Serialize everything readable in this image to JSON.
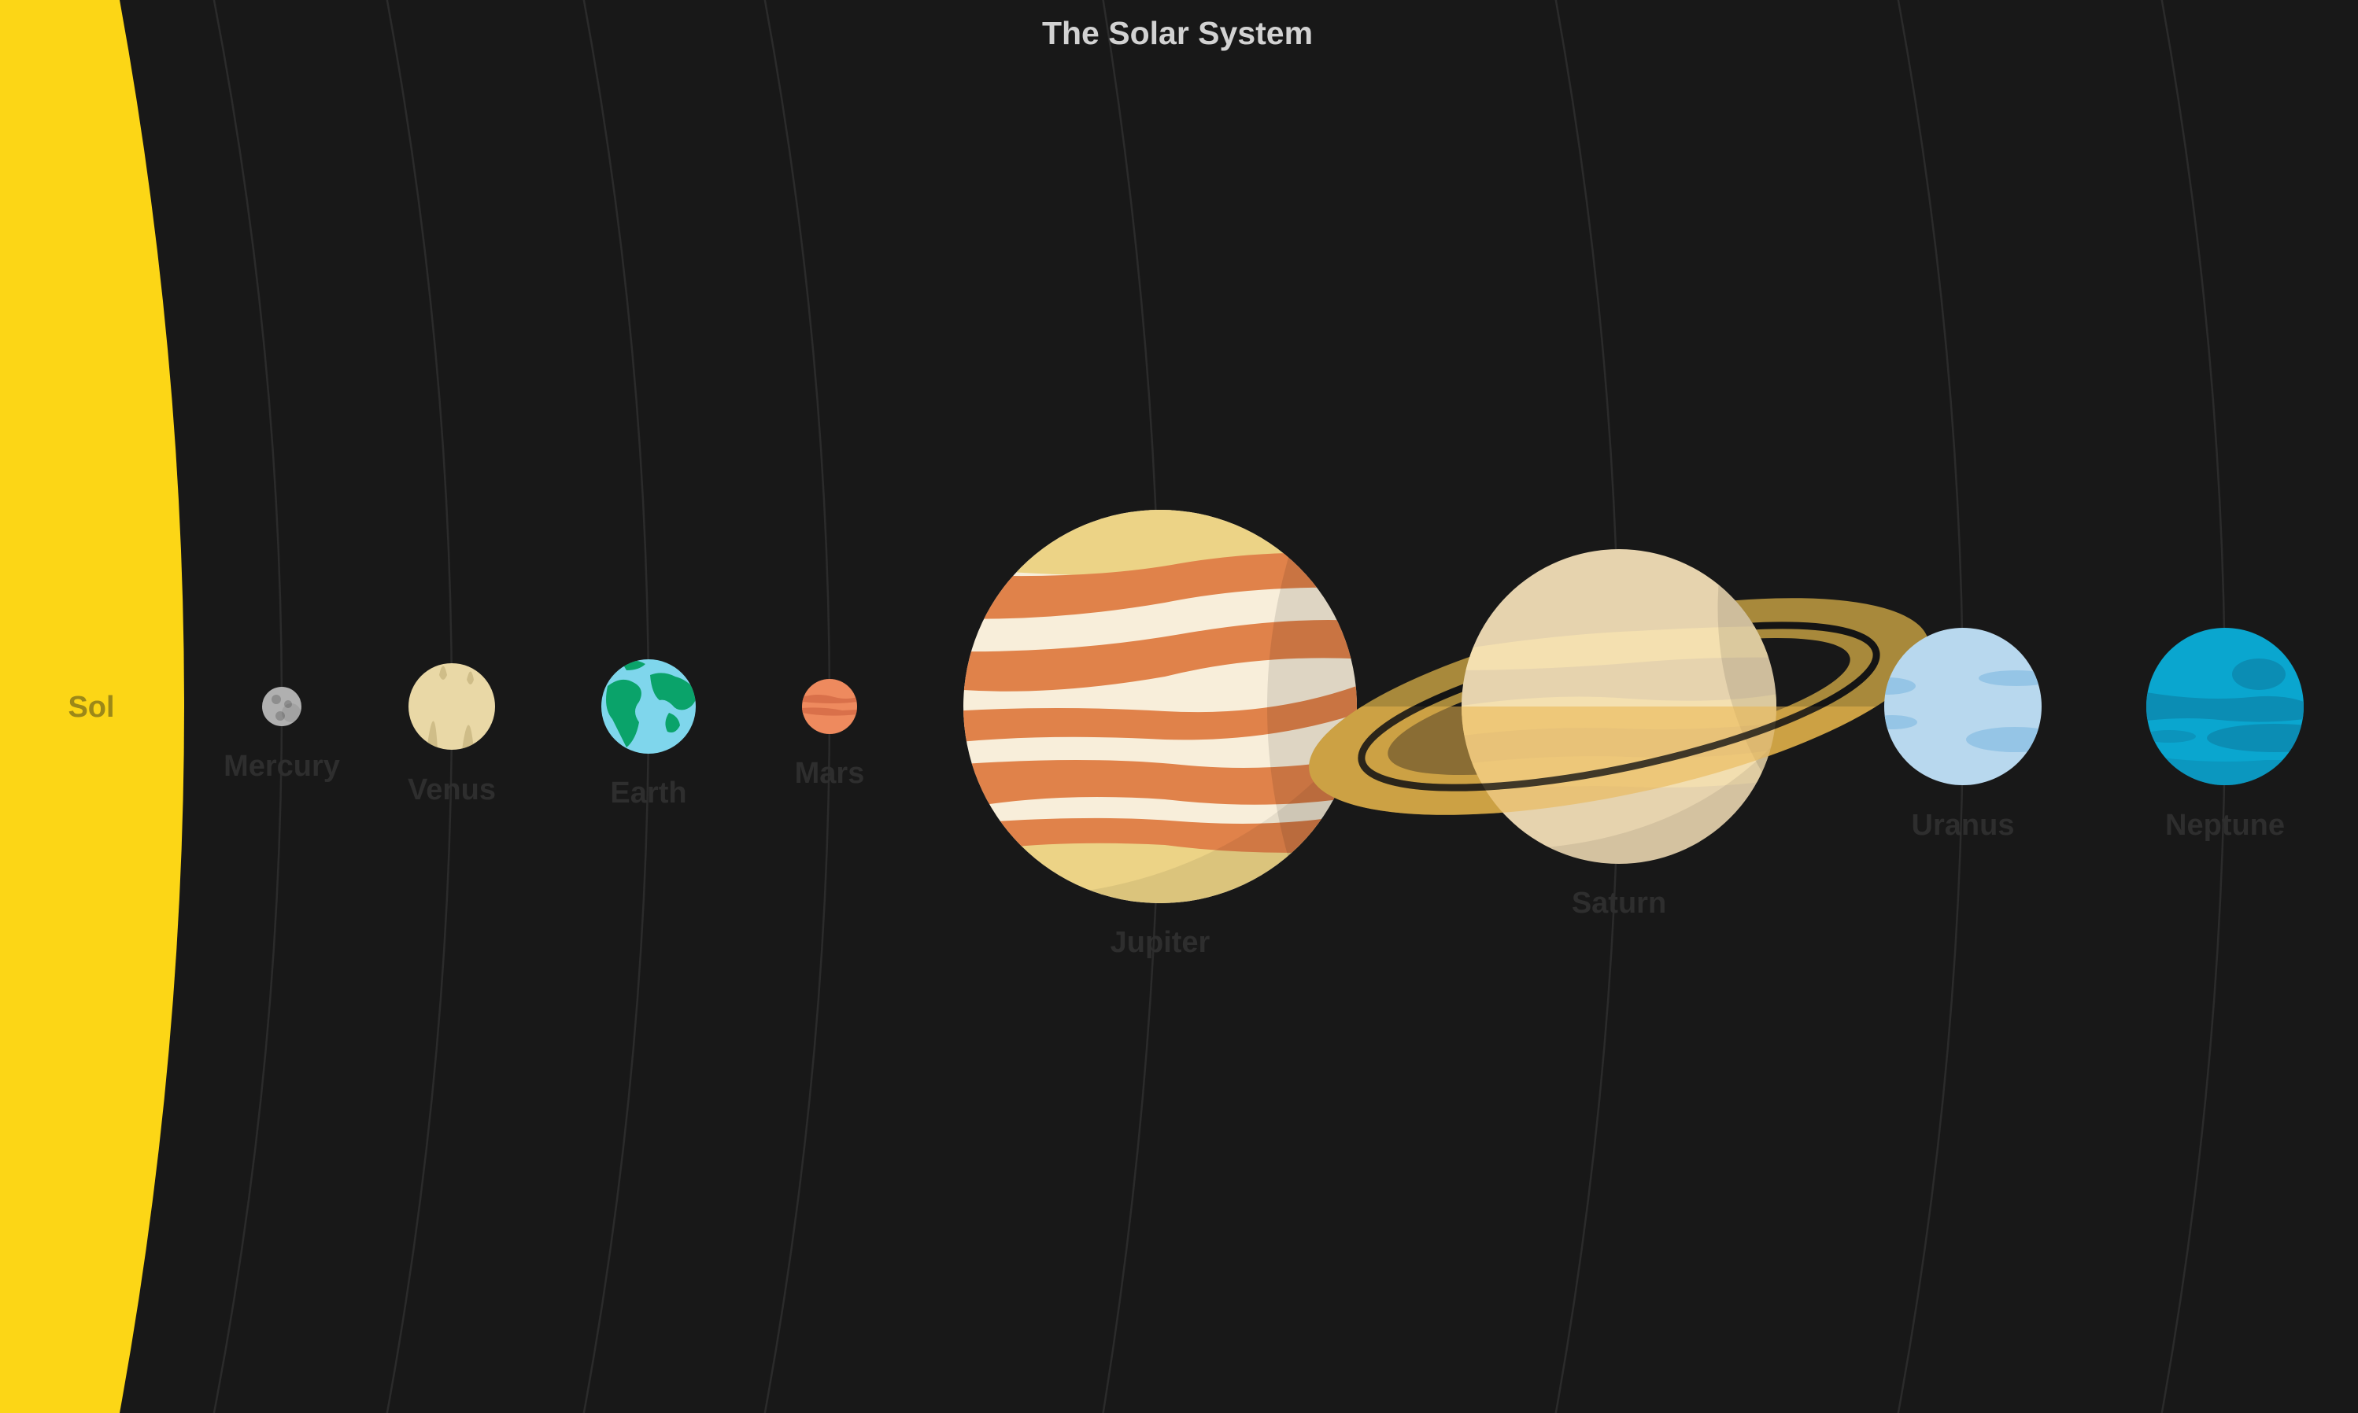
{
  "title": "The Solar System",
  "sun": {
    "label": "Sol",
    "color": "#fcd616"
  },
  "planets": [
    {
      "key": "mercury",
      "label": "Mercury",
      "color": "#b0b0b0"
    },
    {
      "key": "venus",
      "label": "Venus",
      "color": "#e9d8a6"
    },
    {
      "key": "earth",
      "label": "Earth",
      "color": "#7fd6ec"
    },
    {
      "key": "mars",
      "label": "Mars",
      "color": "#ee8a5e"
    },
    {
      "key": "jupiter",
      "label": "Jupiter",
      "color": "#f8eeda"
    },
    {
      "key": "saturn",
      "label": "Saturn",
      "color": "#e6d3ae"
    },
    {
      "key": "uranus",
      "label": "Uranus",
      "color": "#b8d8ee"
    },
    {
      "key": "neptune",
      "label": "Neptune",
      "color": "#0aa6cf"
    }
  ],
  "colors": {
    "background": "#181818",
    "orbit": "#2b2b2b",
    "label": "#2e2e2e",
    "title": "#d2d2d2"
  }
}
